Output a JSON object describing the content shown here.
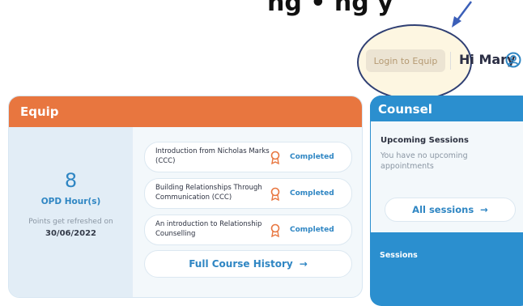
{
  "annotation": {
    "text": "ng   •   ng   y"
  },
  "header": {
    "login_label": "Login to Equip",
    "greeting": "Hi Mary"
  },
  "equip": {
    "title": "Equip",
    "opd_value": "8",
    "opd_label": "OPD Hour(s)",
    "refresh_label": "Points get refreshed on",
    "refresh_date": "30/06/2022",
    "courses": [
      {
        "title": "Introduction from Nicholas Marks (CCC)",
        "status": "Completed"
      },
      {
        "title": "Building Relationships Through Communication (CCC)",
        "status": "Completed"
      },
      {
        "title": "An introduction to Relationship Counselling",
        "status": "Completed"
      }
    ],
    "history_label": "Full Course History",
    "arrow": "→"
  },
  "counsel": {
    "title": "Counsel",
    "upcoming_title": "Upcoming Sessions",
    "upcoming_text": "You have no upcoming appointments",
    "all_sessions_label": "All sessions",
    "arrow": "→",
    "sessions_label": "Sessions"
  },
  "colors": {
    "equip_accent": "#e8763f",
    "counsel_accent": "#2b8fcf",
    "link_blue": "#2f86c3",
    "award_orange": "#e8763f"
  }
}
